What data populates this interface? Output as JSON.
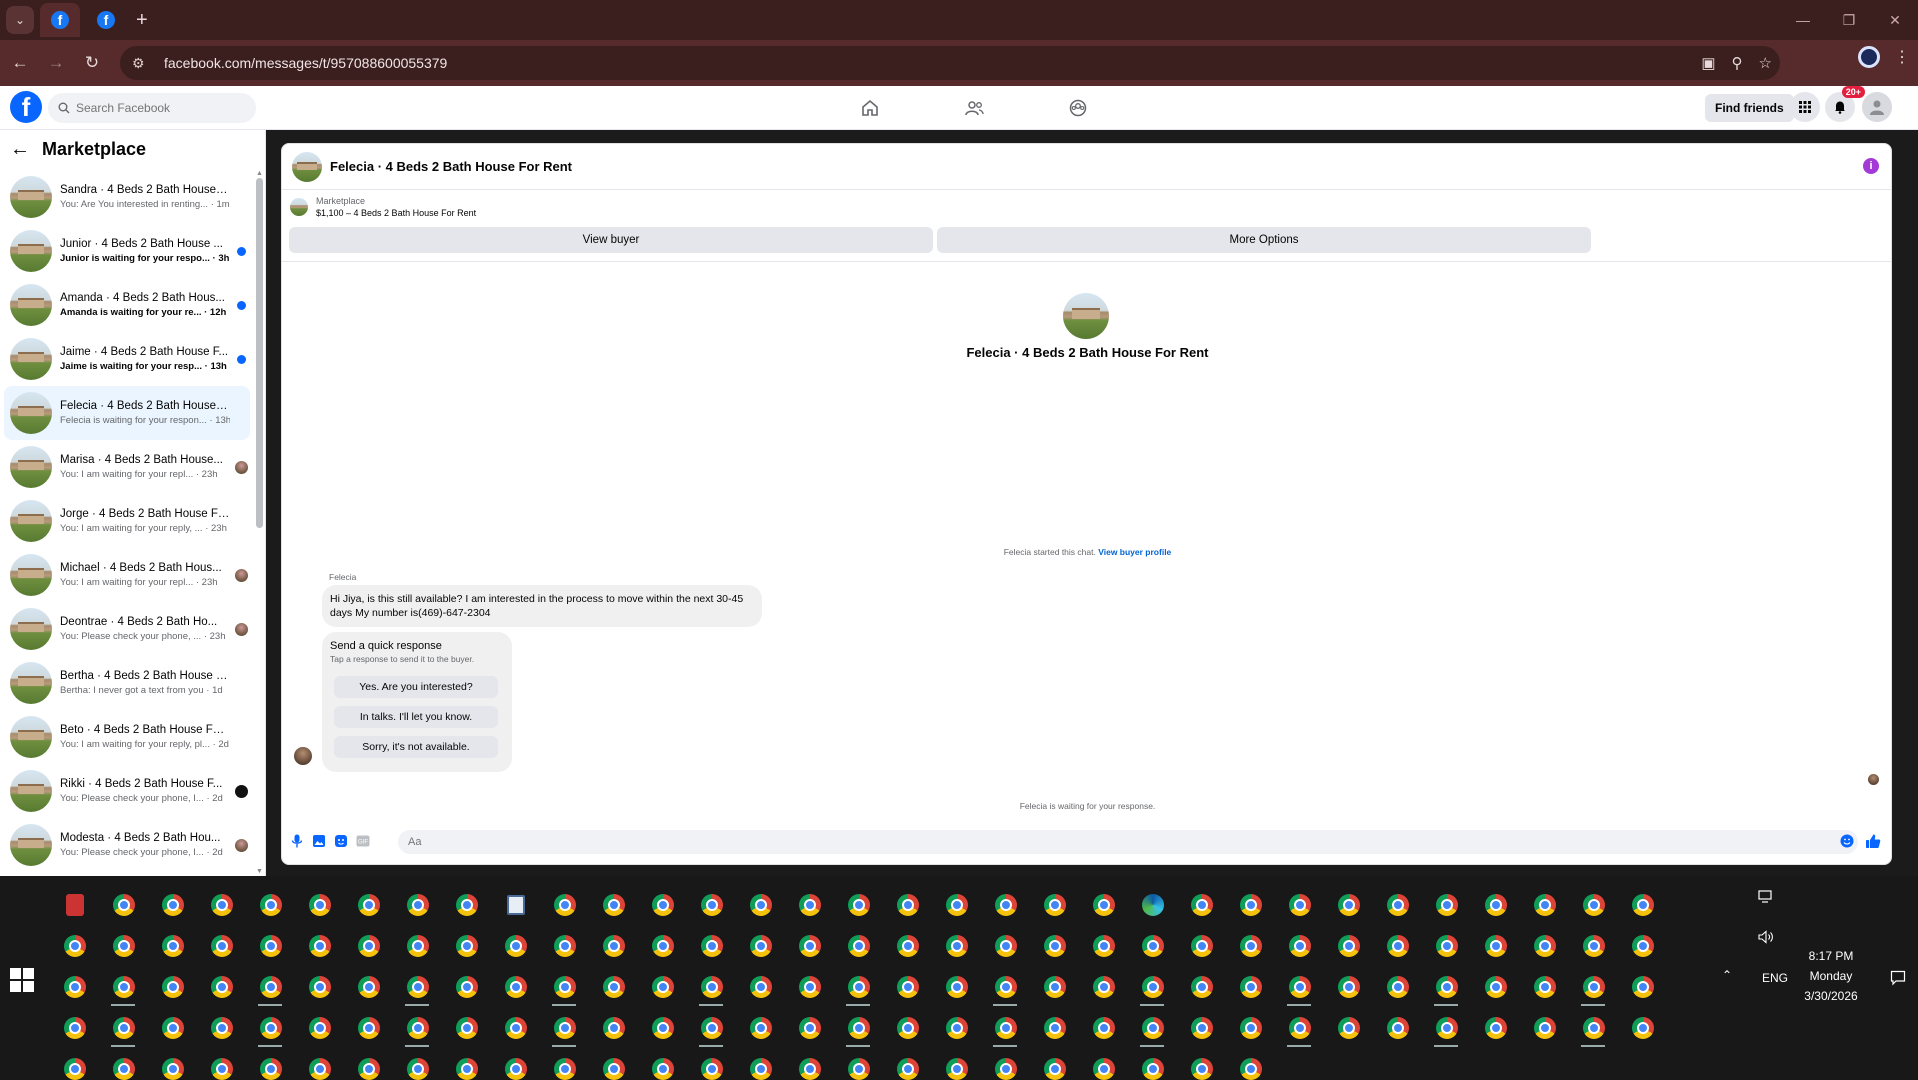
{
  "browser": {
    "url": "facebook.com/messages/t/957088600055379",
    "tabs": [
      {
        "icon": "facebook-icon",
        "active": true
      },
      {
        "icon": "facebook-icon",
        "active": false
      }
    ]
  },
  "fb": {
    "search_placeholder": "Search Facebook",
    "find_friends": "Find friends",
    "notif_badge": "20+"
  },
  "sidebar": {
    "title": "Marketplace",
    "conversations": [
      {
        "name": "Sandra · 4 Beds 2 Bath House F...",
        "sub": "You: Are You interested in renting... · 1m",
        "unread": false,
        "indicator": "none"
      },
      {
        "name": "Junior · 4 Beds 2 Bath House ...",
        "sub": "Junior is waiting for your respo... · 3h",
        "unread": true,
        "indicator": "dot"
      },
      {
        "name": "Amanda · 4 Beds 2 Bath Hous...",
        "sub": "Amanda is waiting for your re... · 12h",
        "unread": true,
        "indicator": "dot"
      },
      {
        "name": "Jaime · 4 Beds 2 Bath House F...",
        "sub": "Jaime is waiting for your resp... · 13h",
        "unread": true,
        "indicator": "dot"
      },
      {
        "name": "Felecia · 4 Beds 2 Bath House F...",
        "sub": "Felecia is waiting for your respon... · 13h",
        "unread": false,
        "indicator": "none",
        "active": true
      },
      {
        "name": "Marisa · 4 Beds 2 Bath House...",
        "sub": "You: I am waiting for your repl... · 23h",
        "unread": false,
        "indicator": "avatar"
      },
      {
        "name": "Jorge · 4 Beds 2 Bath House For...",
        "sub": "You: I am waiting for your reply, ... · 23h",
        "unread": false,
        "indicator": "none"
      },
      {
        "name": "Michael · 4 Beds 2 Bath Hous...",
        "sub": "You: I am waiting for your repl... · 23h",
        "unread": false,
        "indicator": "avatar"
      },
      {
        "name": "Deontrae · 4 Beds 2 Bath Ho...",
        "sub": "You: Please check your phone, ... · 23h",
        "unread": false,
        "indicator": "avatar"
      },
      {
        "name": "Bertha · 4 Beds 2 Bath House F...",
        "sub": "Bertha: I never got a text from you · 1d",
        "unread": false,
        "indicator": "none"
      },
      {
        "name": "Beto · 4 Beds 2 Bath House For ...",
        "sub": "You: I am waiting for your reply, pl... · 2d",
        "unread": false,
        "indicator": "none"
      },
      {
        "name": "Rikki · 4 Beds 2 Bath House F...",
        "sub": "You: Please check your phone, I... · 2d",
        "unread": false,
        "indicator": "black"
      },
      {
        "name": "Modesta · 4 Beds 2 Bath Hou...",
        "sub": "You: Please check your phone, I... · 2d",
        "unread": false,
        "indicator": "avatar"
      }
    ]
  },
  "chat": {
    "title": "Felecia · 4 Beds 2 Bath House For Rent",
    "marketplace_label": "Marketplace",
    "listing": "$1,100 – 4 Beds 2 Bath House For Rent",
    "view_buyer": "View buyer",
    "more_options": "More Options",
    "started_text": "Felecia started this chat.",
    "view_buyer_profile": "View buyer profile",
    "sender": "Felecia",
    "message": "Hi Jiya, is this still available? I am interested in the process to move within the next 30-45 days My number is(469)-647-2304",
    "quick_title": "Send a quick response",
    "quick_hint": "Tap a response to send it to the buyer.",
    "quick_options": [
      "Yes. Are you interested?",
      "In talks. I'll let you know.",
      "Sorry, it's not available."
    ],
    "waiting": "Felecia is waiting for your response.",
    "composer_placeholder": "Aa"
  },
  "taskbar": {
    "lang": "ENG",
    "time": "8:17 PM",
    "day": "Monday",
    "date": "3/30/2026"
  }
}
